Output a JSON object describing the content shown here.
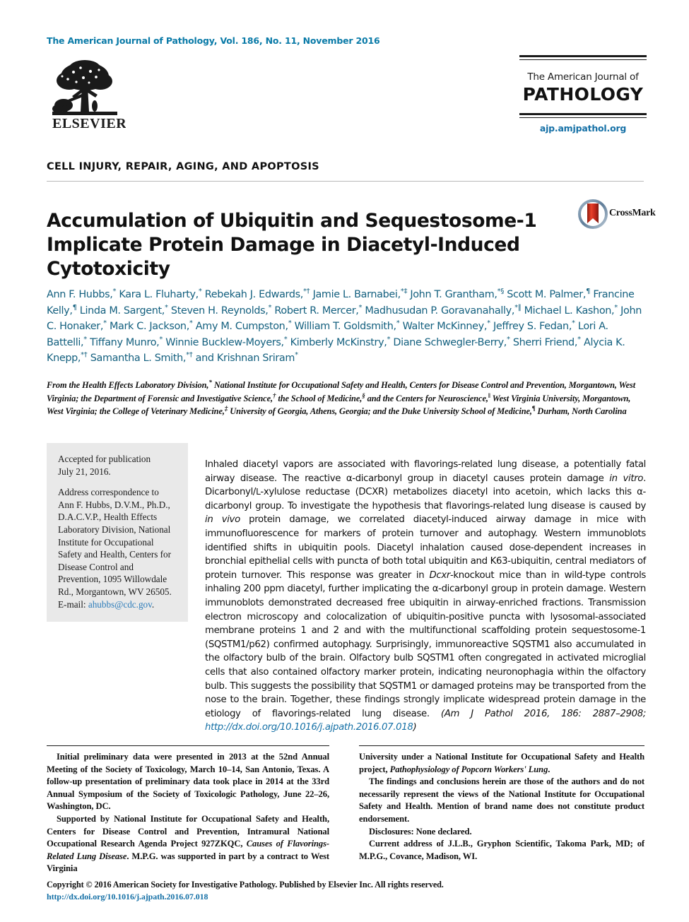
{
  "running_head": "The American Journal of Pathology, Vol. 186, No. 11, November 2016",
  "publisher": {
    "logo_name": "elsevier-tree-logo",
    "wordmark": "ELSEVIER"
  },
  "masthead": {
    "line1": "The American Journal of",
    "line2": "PATHOLOGY",
    "url": "ajp.amjpathol.org",
    "url_color": "#1570a6"
  },
  "section_kicker": "CELL INJURY, REPAIR, AGING, AND APOPTOSIS",
  "title": "Accumulation of Ubiquitin and Sequestosome-1 Implicate Protein Damage in Diacetyl-Induced Cytotoxicity",
  "crossmark": {
    "label": "CrossMark",
    "badge_name": "crossmark-badge-icon"
  },
  "authors_html": "Ann F. Hubbs,<sup>*</sup> Kara L. Fluharty,<sup>*</sup> Rebekah J. Edwards,<sup>*&#8224;</sup> Jamie L. Barnabei,<sup>*&#8225;</sup> John T. Grantham,<sup>*&#167;</sup> Scott M. Palmer,<sup>&#182;</sup> Francine Kelly,<sup>&#182;</sup> Linda M. Sargent,<sup>*</sup> Steven H. Reynolds,<sup>*</sup> Robert R. Mercer,<sup>*</sup> Madhusudan P. Goravanahally,<sup>*&#8214;</sup> Michael L. Kashon,<sup>*</sup> John C. Honaker,<sup>*</sup> Mark C. Jackson,<sup>*</sup> Amy M. Cumpston,<sup>*</sup> William T. Goldsmith,<sup>*</sup> Walter McKinney,<sup>*</sup> Jeffrey S. Fedan,<sup>*</sup> Lori A. Battelli,<sup>*</sup> Tiffany Munro,<sup>*</sup> Winnie Bucklew-Moyers,<sup>*</sup> Kimberly McKinstry,<sup>*</sup> Diane Schwegler-Berry,<sup>*</sup> Sherri Friend,<sup>*</sup> Alycia K. Knepp,<sup>*&#8224;</sup> Samantha L. Smith,<sup>*&#8224;</sup> and Krishnan Sriram<sup>*</sup>",
  "authors_plain": "Ann F. Hubbs, Kara L. Fluharty, Rebekah J. Edwards, Jamie L. Barnabei, John T. Grantham, Scott M. Palmer, Francine Kelly, Linda M. Sargent, Steven H. Reynolds, Robert R. Mercer, Madhusudan P. Goravanahally, Michael L. Kashon, John C. Honaker, Mark C. Jackson, Amy M. Cumpston, William T. Goldsmith, Walter McKinney, Jeffrey S. Fedan, Lori A. Battelli, Tiffany Munro, Winnie Bucklew-Moyers, Kimberly McKinstry, Diane Schwegler-Berry, Sherri Friend, Alycia K. Knepp, Samantha L. Smith, and Krishnan Sriram",
  "authors_color": "#14607f",
  "affiliations_html": "From the Health Effects Laboratory Division,<sup>*</sup> National Institute for Occupational Safety and Health, Centers for Disease Control and Prevention, Morgantown, West Virginia; the Department of Forensic and Investigative Science,<sup>&#8224;</sup> the School of Medicine,<sup>&#167;</sup> and the Centers for Neuroscience,<sup>&#8214;</sup> West Virginia University, Morgantown, West Virginia; the College of Veterinary Medicine,<sup>&#8225;</sup> University of Georgia, Athens, Georgia; and the Duke University School of Medicine,<sup>&#182;</sup> Durham, North Carolina",
  "sidebar": {
    "accepted_label": "Accepted for publication",
    "accepted_date": "July 21, 2016.",
    "correspondence": "Address correspondence to Ann F. Hubbs, D.V.M., Ph.D., D.A.C.V.P., Health Effects Laboratory Division, National Institute for Occupational Safety and Health, Centers for Disease Control and Prevention, 1095 Willowdale Rd., Morgantown, WV 26505. E-mail:",
    "email": "ahubbs@cdc.gov",
    "email_color": "#2b7bb9",
    "background": "#e9e9e9"
  },
  "abstract_html": "Inhaled diacetyl vapors are associated with flavorings-related lung disease, a potentially fatal airway disease. The reactive &#945;-dicarbonyl group in diacetyl causes protein damage <i>in vitro</i>. Dicarbonyl/<span class=\"smallcap\">L</span>-xylulose reductase (DCXR) metabolizes diacetyl into acetoin, which lacks this &#945;-dicarbonyl group. To investigate the hypothesis that flavorings-related lung disease is caused by <i>in vivo</i> protein damage, we correlated diacetyl-induced airway damage in mice with immunofluorescence for markers of protein turnover and autophagy. Western immunoblots identified shifts in ubiquitin pools. Diacetyl inhalation caused dose-dependent increases in bronchial epithelial cells with puncta of both total ubiquitin and K63-ubiquitin, central mediators of protein turnover. This response was greater in <i>Dcxr</i>-knockout mice than in wild-type controls inhaling 200 ppm diacetyl, further implicating the &#945;-dicarbonyl group in protein damage. Western immunoblots demonstrated decreased free ubiquitin in airway-enriched fractions. Transmission electron microscopy and colocalization of ubiquitin-positive puncta with lysosomal-associated membrane proteins 1 and 2 and with the multifunctional scaffolding protein sequestosome-1 (SQSTM1/p62) confirmed autophagy. Surprisingly, immunoreactive SQSTM1 also accumulated in the olfactory bulb of the brain. Olfactory bulb SQSTM1 often congregated in activated microglial cells that also contained olfactory marker protein, indicating neuronophagia within the olfactory bulb. This suggests the possibility that SQSTM1 or damaged proteins may be transported from the nose to the brain. Together, these findings strongly implicate widespread protein damage in the etiology of flavorings-related lung disease. <span class=\"cite\">(Am J Pathol 2016, 186: 2887&#8211;2908; <span class=\"doi\">http://dx.doi.org/10.1016/j.ajpath.2016.07.018</span>)</span>",
  "footnotes": {
    "left_html": "<p>Initial preliminary data were presented in 2013 at the 52nd Annual Meeting of the Society of Toxicology, March 10&#8211;14, San Antonio, Texas. A follow-up presentation of preliminary data took place in 2014 at the 33rd Annual Symposium of the Society of Toxicologic Pathology, June 22&#8211;26, Washington, DC.</p><p>Supported by National Institute for Occupational Safety and Health, Centers for Disease Control and Prevention, Intramural National Occupational Research Agenda Project 927ZKQC, <i>Causes of Flavorings-Related Lung Disease</i>. M.P.G. was supported in part by a contract to West Virginia</p>",
    "right_html": "<p style=\"text-indent:0\">University under a National Institute for Occupational Safety and Health project, <i>Pathophysiology of Popcorn Workers' Lung</i>.</p><p>The findings and conclusions herein are those of the authors and do not necessarily represent the views of the National Institute for Occupational Safety and Health. Mention of brand name does not constitute product endorsement.</p><p>Disclosures: None declared.</p><p>Current address of J.L.B., Gryphon Scientific, Takoma Park, MD; of M.P.G., Covance, Madison, WI.</p>"
  },
  "copyright": {
    "text": "Copyright © 2016 American Society for Investigative Pathology. Published by Elsevier Inc. All rights reserved.",
    "doi": "http://dx.doi.org/10.1016/j.ajpath.2016.07.018",
    "doi_color": "#1570a6"
  }
}
